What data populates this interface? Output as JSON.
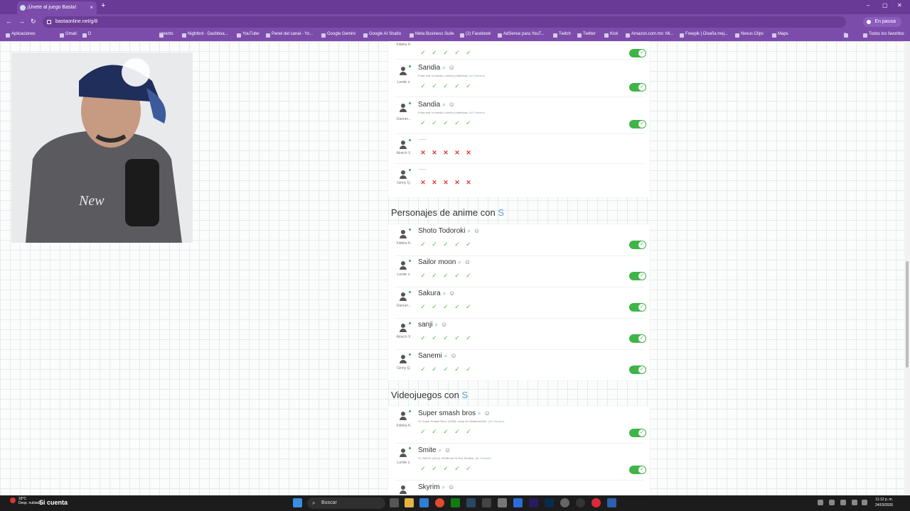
{
  "browser": {
    "tab_title": "¡Únete al juego Basta!",
    "tab_close": "×",
    "new_tab": "+",
    "url": "bastaonline.net/g/8",
    "pause_label": "En pausa",
    "window_controls": [
      "–",
      "▢",
      "✕"
    ],
    "nav": [
      "←",
      "→",
      "↻"
    ]
  },
  "bookmarks": {
    "items": [
      "Aplicaciones",
      "Gmail",
      "D",
      "ements",
      "Nightbot - Dashboa...",
      "YouTube",
      "Panel del canal - Yo...",
      "Google Gemini",
      "Google AI Studio",
      "Meta Business Suite",
      "(2) Facebook",
      "AdSense para YouT...",
      "Twitch",
      "Twitter",
      "Kick",
      "Amazon.com.mx: Mi...",
      "Freepik | Diseña mej...",
      "Nexus Clips",
      "Maps"
    ],
    "more": "»",
    "all_favorites": "Todos los favoritos"
  },
  "sections": [
    {
      "rows": [
        {
          "player": "Xideka K.",
          "answer": "",
          "desc": "",
          "source": "",
          "result": "ok"
        },
        {
          "player": "Lande z.",
          "answer": "Sandia",
          "desc": "Fruta real: la sandía, común y deliciosa.",
          "source": "(AI Checker)",
          "result": "ok"
        },
        {
          "player": "Danner...",
          "answer": "Sandia",
          "desc": "Fruta real: la sandía, común y deliciosa.",
          "source": "(AI Checker)",
          "result": "ok"
        },
        {
          "player": "Almich V.",
          "answer": "",
          "dash": "——",
          "result": "bad"
        },
        {
          "player": "Ginny Q.",
          "answer": "",
          "dash": "——",
          "result": "bad"
        }
      ]
    },
    {
      "title": "Personajes de anime con",
      "letter": "S",
      "rows": [
        {
          "player": "Xideka K.",
          "answer": "Shoto Todoroki",
          "result": "ok"
        },
        {
          "player": "Lande z.",
          "answer": "Sailor moon",
          "result": "ok"
        },
        {
          "player": "Danner...",
          "answer": "Sakura",
          "result": "ok"
        },
        {
          "player": "Almich V.",
          "answer": "sanji",
          "result": "ok"
        },
        {
          "player": "Ginny Q.",
          "answer": "Sanemi",
          "result": "ok"
        }
      ]
    },
    {
      "title": "Videojuegos con",
      "letter": "S",
      "rows": [
        {
          "player": "Xideka K.",
          "answer": "Super smash bros",
          "desc": "SI. Super Smash Bros. (1999), lucha de Nintendo/HAL.",
          "source": "(AI Checker)",
          "result": "ok"
        },
        {
          "player": "Lande z.",
          "answer": "Smite",
          "desc": "SI. SMITE (2014), MOBA de Hi-Rez Studios.",
          "source": "(AI Checker)",
          "result": "ok"
        },
        {
          "player": "",
          "answer": "Skyrim",
          "result": "none"
        }
      ]
    }
  ],
  "icons": {
    "search": "⌕",
    "emoji": "☺",
    "check": "✓",
    "cross": "✕",
    "toggle_check": "✓"
  },
  "taskbar": {
    "weather": "18°C",
    "weather_sub": "Desp. nublado",
    "account": "Si cuenta",
    "search_placeholder": "Buscar",
    "time": "11:12 p. m.",
    "date": "24/03/2026"
  },
  "colors": {
    "browser": "#7c4cab",
    "ok": "#4cbf4f",
    "bad": "#e23b3b",
    "toggle": "#3fb447",
    "letter": "#4f9fe0"
  }
}
